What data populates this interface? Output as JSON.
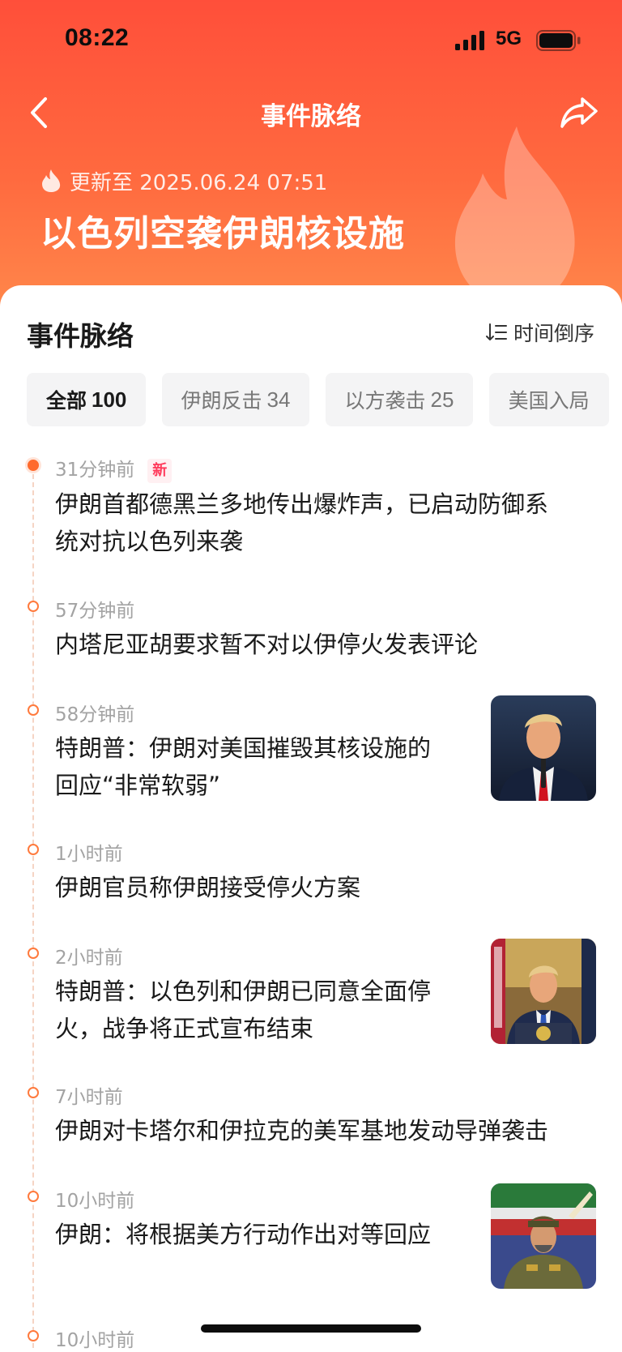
{
  "status_bar": {
    "time": "08:22",
    "network": "5G"
  },
  "nav": {
    "title": "事件脉络",
    "back_icon": "chevron-left-icon",
    "share_icon": "share-arrow-icon"
  },
  "header": {
    "update_text": "更新至 2025.06.24 07:51",
    "event_title": "以色列空袭伊朗核设施",
    "accent_color": "#ff5a3c"
  },
  "section": {
    "title": "事件脉络",
    "sort_label": "时间倒序"
  },
  "tabs": [
    {
      "label": "全部",
      "count": "100",
      "active": true
    },
    {
      "label": "伊朗反击",
      "count": "34",
      "active": false
    },
    {
      "label": "以方袭击",
      "count": "25",
      "active": false
    },
    {
      "label": "美国入局",
      "count": "",
      "active": false
    }
  ],
  "timeline": [
    {
      "time": "31分钟前",
      "badge": "新",
      "headline_lines": [
        "伊朗首都德黑兰多地传出爆炸声，已启动防御系",
        "统对抗以色列来袭"
      ],
      "has_image": false
    },
    {
      "time": "57分钟前",
      "badge": "",
      "headline_lines": [
        "内塔尼亚胡要求暂不对以伊停火发表评论"
      ],
      "has_image": false
    },
    {
      "time": "58分钟前",
      "badge": "",
      "headline_lines": [
        "特朗普：伊朗对美国摧毁其核设施的",
        "回应“非常软弱”"
      ],
      "has_image": true
    },
    {
      "time": "1小时前",
      "badge": "",
      "headline_lines": [
        "伊朗官员称伊朗接受停火方案"
      ],
      "has_image": false
    },
    {
      "time": "2小时前",
      "badge": "",
      "headline_lines": [
        "特朗普：以色列和伊朗已同意全面停",
        "火，战争将正式宣布结束"
      ],
      "has_image": true
    },
    {
      "time": "7小时前",
      "badge": "",
      "headline_lines": [
        "伊朗对卡塔尔和伊拉克的美军基地发动导弹袭击"
      ],
      "has_image": false
    },
    {
      "time": "10小时前",
      "badge": "",
      "headline_lines": [
        "伊朗：将根据美方行动作出对等回应"
      ],
      "has_image": true
    },
    {
      "time": "10小时前",
      "badge": "",
      "headline_lines": [],
      "has_image": false
    }
  ]
}
